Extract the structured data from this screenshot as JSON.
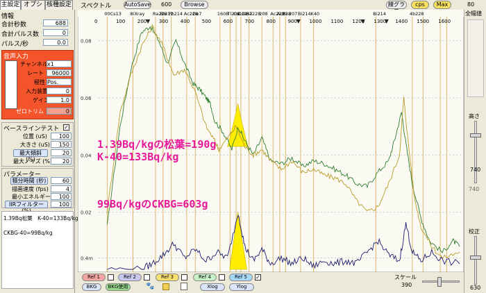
{
  "tabs": [
    {
      "label": "主設定"
    },
    {
      "label": "オプション"
    },
    {
      "label": "核種設定"
    }
  ],
  "info": {
    "title": "情報",
    "rows": [
      {
        "label": "合計秒数",
        "value": "688"
      },
      {
        "label": "合計パルス数",
        "value": "0"
      },
      {
        "label": "パルス/秒",
        "value": "0.0"
      }
    ]
  },
  "audio": {
    "title": "音声入力",
    "channel_label": "チャンネル",
    "channel_value": "x1",
    "rate_label": "レート",
    "rate_value": "96000",
    "polarity_label": "極性",
    "polarity_value": "Pos.",
    "input_label": "入力装置",
    "input_value": "0",
    "gain_label": "ゲイン",
    "gain_value": "1.0",
    "zero_label": "ゼロトリム",
    "zero_value": "0"
  },
  "baseline": {
    "title": "ベースラインテスト",
    "rows": [
      {
        "label": "位置 (uS)",
        "value": "100"
      },
      {
        "label": "大きさ (uS)",
        "value": "150"
      }
    ],
    "max_tilt_button": "最大傾斜 (%)",
    "max_tilt_value": "20",
    "max_noise_label": "最大ノイズ (%)",
    "max_noise_value": "20"
  },
  "params": {
    "title": "パラメーター",
    "integration_button": "積分時間 (秒)",
    "integration_value": "60",
    "draw_label": "描画速度 (fps)",
    "draw_value": "4",
    "min_energy_label": "最小エネルギー",
    "min_energy_value": "100",
    "iir_button": "IIRフィルター (%)",
    "iir_value": "100"
  },
  "notes": {
    "line1": "1.39Bq松葉　K-40=133Bq/kg",
    "line2": "CKBG-40=99Bq/kg"
  },
  "topbar": {
    "title": "スペクトル",
    "autosave": "AutoSave",
    "autosave_value": "600",
    "browse": "Browse",
    "line_graph": "線グラフ",
    "cps": "cps",
    "max": "Max",
    "right_value": "80"
  },
  "chart_data": {
    "type": "line",
    "xlabel": "",
    "ylabel": "",
    "xlim": [
      0,
      1680
    ],
    "ylim": [
      0,
      0.085
    ],
    "x_ticks": [
      0,
      100,
      200,
      300,
      400,
      500,
      600,
      700,
      800,
      900,
      1000,
      1100,
      1200,
      1300,
      1400,
      1500,
      1600
    ],
    "y_tick_labels": [
      {
        "value": 0.08,
        "label": "0.08"
      },
      {
        "value": 0.06,
        "label": "0.06"
      },
      {
        "value": 0.04,
        "label": "0.04"
      },
      {
        "value": 0.02,
        "label": "0.02"
      },
      {
        "value": 0.004,
        "label": "0.4m"
      }
    ],
    "nuclide_labels": [
      "00Cs13",
      "8iXray",
      "Ra226",
      "Bi212",
      "Pb214",
      "Ac228",
      "Ge7",
      "1608",
      "Tl208",
      "Cs134",
      "Cs137",
      "Ra228",
      "208",
      "Ac228",
      "Ac228",
      "Bi-207",
      "Bi214",
      "K40",
      "Bi214",
      "4b228"
    ],
    "nuclide_positions": [
      40,
      160,
      265,
      300,
      338,
      410,
      450,
      565,
      612,
      640,
      662,
      700,
      760,
      812,
      843,
      870,
      940,
      1000,
      1290,
      1460,
      1510,
      1590,
      1620
    ],
    "series": [
      {
        "color": "#2f7d2f",
        "values": [
          [
            40,
            0.015
          ],
          [
            100,
            0.05
          ],
          [
            150,
            0.07
          ],
          [
            200,
            0.083
          ],
          [
            240,
            0.085
          ],
          [
            280,
            0.08
          ],
          [
            320,
            0.072
          ],
          [
            360,
            0.08
          ],
          [
            400,
            0.072
          ],
          [
            440,
            0.065
          ],
          [
            470,
            0.063
          ],
          [
            500,
            0.06
          ],
          [
            520,
            0.058
          ],
          [
            540,
            0.052
          ],
          [
            580,
            0.048
          ],
          [
            620,
            0.042
          ],
          [
            650,
            0.05
          ],
          [
            680,
            0.045
          ],
          [
            720,
            0.04
          ],
          [
            760,
            0.046
          ],
          [
            800,
            0.038
          ],
          [
            850,
            0.037
          ],
          [
            900,
            0.039
          ],
          [
            950,
            0.036
          ],
          [
            1000,
            0.038
          ],
          [
            1050,
            0.037
          ],
          [
            1100,
            0.035
          ],
          [
            1150,
            0.033
          ],
          [
            1200,
            0.03
          ],
          [
            1250,
            0.029
          ],
          [
            1300,
            0.034
          ],
          [
            1350,
            0.038
          ],
          [
            1380,
            0.046
          ],
          [
            1410,
            0.055
          ],
          [
            1430,
            0.044
          ],
          [
            1460,
            0.03
          ],
          [
            1500,
            0.018
          ],
          [
            1540,
            0.01
          ],
          [
            1600,
            0.006
          ],
          [
            1650,
            0.01
          ],
          [
            1680,
            0.008
          ]
        ]
      },
      {
        "color": "#b89b2a",
        "values": [
          [
            40,
            0.02
          ],
          [
            100,
            0.055
          ],
          [
            150,
            0.068
          ],
          [
            200,
            0.078
          ],
          [
            250,
            0.085
          ],
          [
            300,
            0.078
          ],
          [
            350,
            0.068
          ],
          [
            400,
            0.07
          ],
          [
            450,
            0.062
          ],
          [
            500,
            0.05
          ],
          [
            540,
            0.045
          ],
          [
            560,
            0.042
          ],
          [
            600,
            0.046
          ],
          [
            640,
            0.05
          ],
          [
            680,
            0.043
          ],
          [
            720,
            0.04
          ],
          [
            760,
            0.042
          ],
          [
            800,
            0.038
          ],
          [
            850,
            0.035
          ],
          [
            900,
            0.038
          ],
          [
            950,
            0.034
          ],
          [
            1000,
            0.035
          ],
          [
            1050,
            0.033
          ],
          [
            1100,
            0.032
          ],
          [
            1150,
            0.03
          ],
          [
            1200,
            0.024
          ],
          [
            1250,
            0.02
          ],
          [
            1300,
            0.022
          ],
          [
            1350,
            0.03
          ],
          [
            1400,
            0.04
          ],
          [
            1420,
            0.06
          ],
          [
            1440,
            0.045
          ],
          [
            1470,
            0.025
          ],
          [
            1500,
            0.015
          ],
          [
            1550,
            0.008
          ],
          [
            1600,
            0.004
          ],
          [
            1680,
            0.006
          ]
        ]
      },
      {
        "color": "#1a1a70",
        "values": [
          [
            40,
            0
          ],
          [
            200,
            0
          ],
          [
            250,
            0.002
          ],
          [
            300,
            0.005
          ],
          [
            350,
            0.009
          ],
          [
            400,
            0.004
          ],
          [
            450,
            0.007
          ],
          [
            500,
            0.003
          ],
          [
            550,
            0.006
          ],
          [
            600,
            0.004
          ],
          [
            650,
            0.02
          ],
          [
            680,
            0.008
          ],
          [
            720,
            0.003
          ],
          [
            760,
            0.007
          ],
          [
            800,
            0.002
          ],
          [
            850,
            0.004
          ],
          [
            900,
            0.002
          ],
          [
            950,
            0.004
          ],
          [
            1000,
            0.001
          ],
          [
            1050,
            0.003
          ],
          [
            1100,
            0.002
          ],
          [
            1150,
            0.003
          ],
          [
            1200,
            0.002
          ],
          [
            1250,
            0.006
          ],
          [
            1300,
            0.01
          ],
          [
            1350,
            0.005
          ],
          [
            1400,
            0.003
          ],
          [
            1430,
            0.016
          ],
          [
            1460,
            0.006
          ],
          [
            1500,
            0.003
          ],
          [
            1550,
            0.006
          ],
          [
            1600,
            0.003
          ],
          [
            1680,
            0.002
          ]
        ]
      }
    ],
    "highlight_upper": {
      "color": "#ffee00",
      "center": 648,
      "x_range": [
        600,
        695
      ],
      "peak": 0.058,
      "base": 0.043
    },
    "highlight_lower": {
      "color": "#ffee00",
      "center": 648,
      "x_range": [
        610,
        690
      ],
      "peak": 0.02,
      "base": 0.0
    }
  },
  "overlay": {
    "line1": "1.39Bq/kgの松葉=190g",
    "line2": "K-40=133Bq/kg",
    "line3": "99Bq/kgのCKBG=603g"
  },
  "right_panel": {
    "label_top": "全幅値",
    "label_height": "高さ",
    "height_value": "740",
    "tick_740": "740",
    "label_calib": "校正",
    "calib_value": "630"
  },
  "bottom": {
    "ref1": "Ref 1",
    "ref2": "Ref 2",
    "ref3": "Ref 3",
    "ref4": "Ref 4",
    "ref5": "Ref 5",
    "bkg": "BKG",
    "bkg_use": "BKG使用",
    "xlog": "Xlog",
    "ylog": "Ylog",
    "scale_label": "スケール",
    "scale_value": "390"
  },
  "colors": {
    "audio_bg": "#f4542a",
    "chart_bg": "#fafaf2",
    "grid_line": "#d4a040",
    "overlay_text": "#e8199a"
  }
}
